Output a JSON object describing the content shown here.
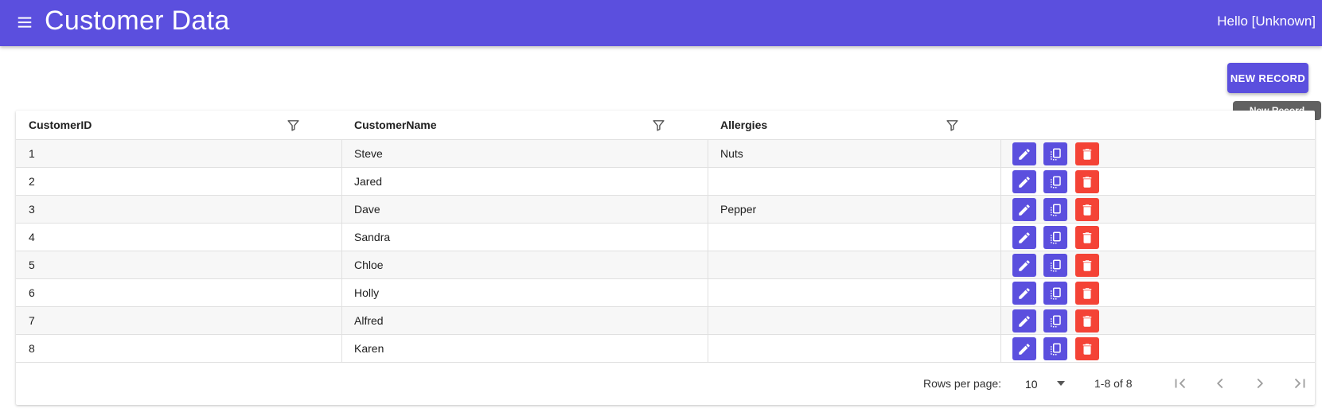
{
  "appbar": {
    "title": "Customer Data",
    "greeting": "Hello [Unknown]"
  },
  "toolbar": {
    "new_record_label": "NEW RECORD",
    "new_record_tooltip": "New Record"
  },
  "table": {
    "columns": [
      "CustomerID",
      "CustomerName",
      "Allergies"
    ],
    "rows": [
      {
        "id": "1",
        "name": "Steve",
        "allergies": "Nuts"
      },
      {
        "id": "2",
        "name": "Jared",
        "allergies": ""
      },
      {
        "id": "3",
        "name": "Dave",
        "allergies": "Pepper"
      },
      {
        "id": "4",
        "name": "Sandra",
        "allergies": ""
      },
      {
        "id": "5",
        "name": "Chloe",
        "allergies": ""
      },
      {
        "id": "6",
        "name": "Holly",
        "allergies": ""
      },
      {
        "id": "7",
        "name": "Alfred",
        "allergies": ""
      },
      {
        "id": "8",
        "name": "Karen",
        "allergies": ""
      }
    ],
    "row_actions": [
      "pencil-icon",
      "copy-icon",
      "trash-icon"
    ]
  },
  "pagination": {
    "rows_per_page_label": "Rows per page:",
    "rows_per_page_value": "10",
    "range_label": "1-8 of 8",
    "nav_icons": [
      "first-page-icon",
      "prev-page-icon",
      "next-page-icon",
      "last-page-icon"
    ]
  },
  "colors": {
    "primary": "#5b4fde",
    "danger": "#f44336",
    "tooltip": "#616161"
  }
}
